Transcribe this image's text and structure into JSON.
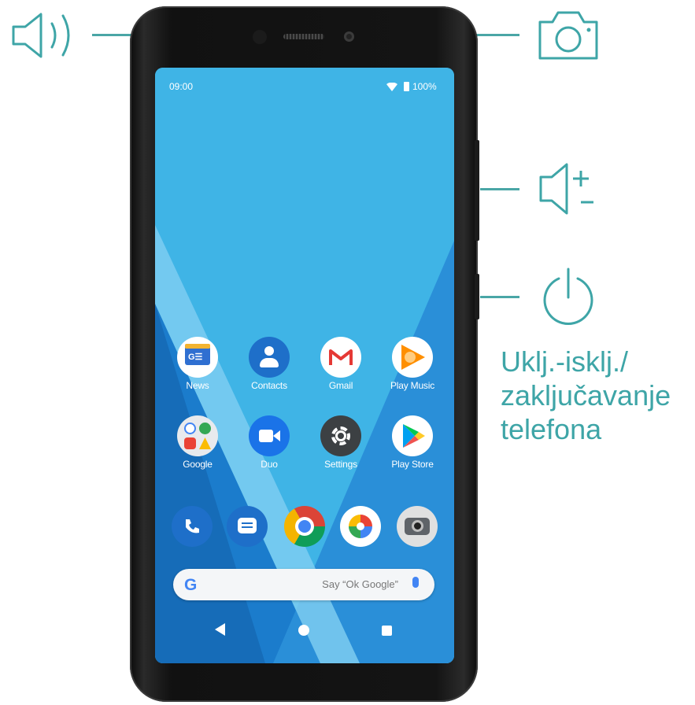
{
  "colors": {
    "accent": "#3ea5a7",
    "screen": "#3fb4e6"
  },
  "status_bar": {
    "time": "09:00",
    "battery": "100%"
  },
  "home_apps": [
    {
      "label": "News",
      "icon": "news-icon"
    },
    {
      "label": "Contacts",
      "icon": "contacts-icon"
    },
    {
      "label": "Gmail",
      "icon": "gmail-icon"
    },
    {
      "label": "Play Music",
      "icon": "play-music-icon"
    },
    {
      "label": "Google",
      "icon": "google-folder-icon"
    },
    {
      "label": "Duo",
      "icon": "duo-icon"
    },
    {
      "label": "Settings",
      "icon": "settings-icon"
    },
    {
      "label": "Play Store",
      "icon": "play-store-icon"
    }
  ],
  "dock_apps": [
    "phone-icon",
    "messages-icon",
    "chrome-icon",
    "photos-icon",
    "camera-icon"
  ],
  "search_bar": {
    "logo": "G",
    "hint": "Say “Ok Google”"
  },
  "callouts": {
    "earpiece": {
      "icon": "speaker-icon"
    },
    "front_camera": {
      "icon": "camera-icon"
    },
    "volume_buttons": {
      "icon": "volume-up-down-icon"
    },
    "power_button": {
      "icon": "power-icon",
      "label_lines": [
        "Uklj.-isklj./",
        "zaključavanje",
        "telefona"
      ]
    }
  }
}
